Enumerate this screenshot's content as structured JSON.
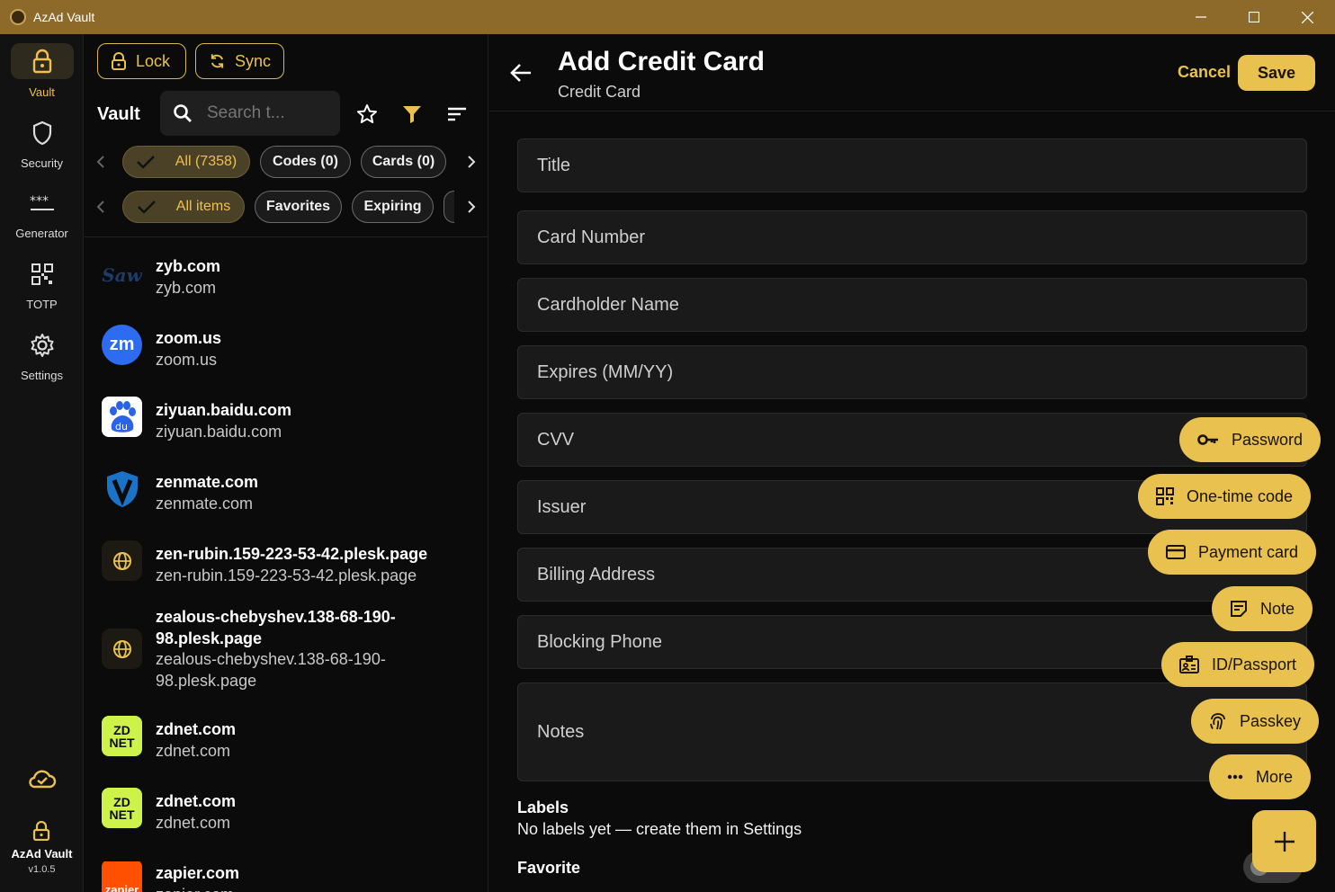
{
  "window": {
    "title": "AzAd Vault"
  },
  "rail": {
    "items": [
      {
        "label": "Vault",
        "icon": "lock-icon"
      },
      {
        "label": "Security",
        "icon": "shield-icon"
      },
      {
        "label": "Generator",
        "icon": "password-dots-icon"
      },
      {
        "label": "TOTP",
        "icon": "qr-code-icon"
      },
      {
        "label": "Settings",
        "icon": "gear-icon"
      }
    ],
    "app_name": "AzAd Vault",
    "version": "v1.0.5"
  },
  "list": {
    "lock_label": "Lock",
    "sync_label": "Sync",
    "vault_label": "Vault",
    "search_placeholder": "Search t...",
    "type_chips": [
      "All (7358)",
      "Codes (0)",
      "Cards (0)"
    ],
    "filter_chips": [
      "All items",
      "Favorites",
      "Expiring"
    ],
    "entries": [
      {
        "title": "zyb.com",
        "subtitle": "zyb.com"
      },
      {
        "title": "zoom.us",
        "subtitle": "zoom.us"
      },
      {
        "title": "ziyuan.baidu.com",
        "subtitle": "ziyuan.baidu.com"
      },
      {
        "title": "zenmate.com",
        "subtitle": "zenmate.com"
      },
      {
        "title": "zen-rubin.159-223-53-42.plesk.page",
        "subtitle": "zen-rubin.159-223-53-42.plesk.page"
      },
      {
        "title": "zealous-chebyshev.138-68-190-98.plesk.page",
        "subtitle": "zealous-chebyshev.138-68-190-98.plesk.page"
      },
      {
        "title": "zdnet.com",
        "subtitle": "zdnet.com"
      },
      {
        "title": "zdnet.com",
        "subtitle": "zdnet.com"
      },
      {
        "title": "zapier.com",
        "subtitle": "zapier.com"
      }
    ],
    "logos": {
      "zyb": "Saw",
      "zoom": "zm",
      "baidu": "du",
      "zdnet": "ZD NET",
      "zapier": "zapier"
    }
  },
  "form": {
    "title": "Add Credit Card",
    "subtitle": "Credit Card",
    "cancel_label": "Cancel",
    "save_label": "Save",
    "fields": [
      "Title",
      "Card Number",
      "Cardholder Name",
      "Expires (MM/YY)",
      "CVV",
      "Issuer",
      "Billing Address",
      "Blocking Phone",
      "Notes"
    ],
    "labels_heading": "Labels",
    "labels_text": "No labels yet — create them in Settings",
    "favorite_heading": "Favorite"
  },
  "fab_menu": [
    "Password",
    "One-time code",
    "Payment card",
    "Note",
    "ID/Passport",
    "Passkey",
    "More"
  ],
  "colors": {
    "accent": "#e9c14e",
    "titlebar": "#8d6a2a",
    "background": "#0b0b0b",
    "field": "#1a1a1a"
  }
}
